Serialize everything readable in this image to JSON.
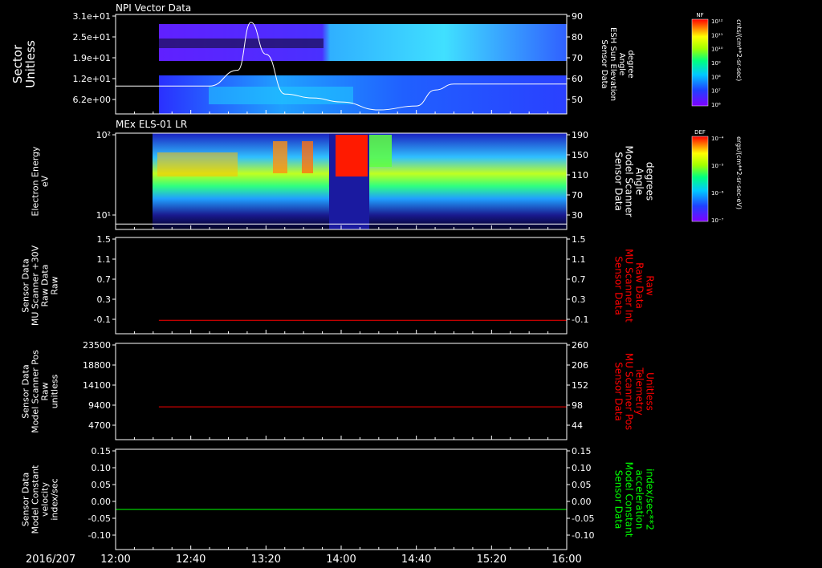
{
  "colors": {
    "background": "#000000",
    "axis": "#ffffff",
    "right_label_panel3": "#ff0000",
    "right_label_panel4": "#ff0000",
    "right_label_panel5": "#00ff00"
  },
  "time_axis": {
    "date_label": "2016/207",
    "ticks": [
      "12:00",
      "12:40",
      "13:20",
      "14:00",
      "14:40",
      "15:20",
      "16:00"
    ]
  },
  "panels": [
    {
      "id": "npi",
      "title": "NPI Vector Data",
      "left_label": [
        "Sector",
        "Unitless"
      ],
      "left_ticks": [
        "3.1e+01",
        "2.5e+01",
        "1.9e+01",
        "1.2e+01",
        "6.2e+00"
      ],
      "right_label": [
        "Sensor Data",
        "ESH Sun Elevation",
        "Angle",
        "degree"
      ],
      "right_ticks": [
        "90",
        "80",
        "70",
        "60",
        "50"
      ],
      "colorbar": {
        "name": "NF",
        "unit": "cnts/(cm**2-sr-sec)",
        "ticks": [
          "10¹²",
          "10¹¹",
          "10¹⁰",
          "10⁹",
          "10⁸",
          "10⁷",
          "10⁶"
        ]
      }
    },
    {
      "id": "els",
      "title": "MEx ELS-01 LR",
      "left_label": [
        "Electron Energy",
        "eV"
      ],
      "left_ticks": [
        "10²",
        "10¹"
      ],
      "right_label": [
        "Sensor Data",
        "Model Scanner",
        "Angle",
        "degrees"
      ],
      "right_ticks": [
        "190",
        "150",
        "110",
        "70",
        "30"
      ],
      "colorbar": {
        "name": "DEF",
        "unit": "ergs/(cm**2-sr-sec-eV)",
        "ticks": [
          "10⁻⁴",
          "10⁻⁵",
          "10⁻⁶",
          "10⁻⁷"
        ]
      }
    },
    {
      "id": "mu_raw",
      "title": "",
      "left_label": [
        "Sensor Data",
        "MU Scanner +30V",
        "Raw Data",
        "Raw"
      ],
      "left_ticks": [
        "1.5",
        "1.1",
        "0.7",
        "0.3",
        "-0.1"
      ],
      "right_label": [
        "Sensor Data",
        "MU Scanner Int",
        "Raw Data",
        "Raw"
      ],
      "right_ticks": [
        "1.5",
        "1.1",
        "0.7",
        "0.3",
        "-0.1"
      ]
    },
    {
      "id": "scanner_pos",
      "title": "",
      "left_label": [
        "Sensor Data",
        "Model Scanner Pos",
        "Raw",
        "unitless"
      ],
      "left_ticks": [
        "23500",
        "18800",
        "14100",
        "9400",
        "4700"
      ],
      "right_label": [
        "Sensor Data",
        "MU Scanner Pos",
        "Telemetry",
        "Unitless"
      ],
      "right_ticks": [
        "260",
        "206",
        "152",
        "98",
        "44"
      ]
    },
    {
      "id": "constant",
      "title": "",
      "left_label": [
        "Sensor Data",
        "Model Constant",
        "velocity",
        "index/sec"
      ],
      "left_ticks": [
        "0.15",
        "0.10",
        "0.05",
        "0.00",
        "-0.05",
        "-0.10"
      ],
      "right_label": [
        "Sensor Data",
        "Model Constant",
        "acceleration",
        "index/sec**2"
      ],
      "right_ticks": [
        "0.15",
        "0.10",
        "0.05",
        "0.00",
        "-0.05",
        "-0.10"
      ]
    }
  ],
  "chart_data": [
    {
      "type": "heatmap",
      "title": "NPI Vector Data",
      "xlabel": "",
      "ylabel": "Sector Unitless",
      "x_range": [
        "12:00",
        "16:00"
      ],
      "data_start": "12:43",
      "y_ticks": [
        31,
        25,
        19,
        12,
        6.2
      ],
      "overlay_line": {
        "name": "ESH Sun Elevation Angle",
        "ylim": [
          40,
          90
        ],
        "x": [
          "12:00",
          "12:50",
          "13:05",
          "13:12",
          "13:20",
          "13:30",
          "13:45",
          "14:00",
          "14:20",
          "14:40",
          "14:50",
          "15:00",
          "16:00"
        ],
        "y": [
          54,
          54,
          62,
          86,
          70,
          50,
          48,
          46,
          42,
          44,
          52,
          55,
          55
        ]
      }
    },
    {
      "type": "heatmap",
      "title": "MEx ELS-01 LR",
      "xlabel": "",
      "ylabel": "Electron Energy eV",
      "x_range": [
        "12:00",
        "16:00"
      ],
      "data_start": "12:37",
      "yscale": "log",
      "overlay_line": {
        "name": "Model Scanner Angle",
        "ylim": [
          10,
          190
        ],
        "x": [
          "12:00",
          "16:00"
        ],
        "y": [
          20,
          20
        ]
      }
    },
    {
      "type": "line",
      "xlabel": "",
      "ylabel": "MU Scanner +30V Raw",
      "ylim": [
        -0.3,
        1.5
      ],
      "series": [
        {
          "color": "#ff0000",
          "x": [
            "12:23",
            "16:00"
          ],
          "y": [
            -0.05,
            -0.05
          ]
        }
      ]
    },
    {
      "type": "line",
      "xlabel": "",
      "ylabel": "Model Scanner Pos Raw unitless",
      "ylim": [
        0,
        23500
      ],
      "series": [
        {
          "color": "#ff0000",
          "x": [
            "12:23",
            "16:00"
          ],
          "y": [
            8000,
            8000
          ]
        }
      ]
    },
    {
      "type": "line",
      "xlabel": "",
      "ylabel": "Model Constant velocity index/sec",
      "ylim": [
        -0.1,
        0.15
      ],
      "series": [
        {
          "color": "#00ff00",
          "x": [
            "12:00",
            "16:00"
          ],
          "y": [
            0.0,
            0.0
          ]
        }
      ]
    }
  ]
}
